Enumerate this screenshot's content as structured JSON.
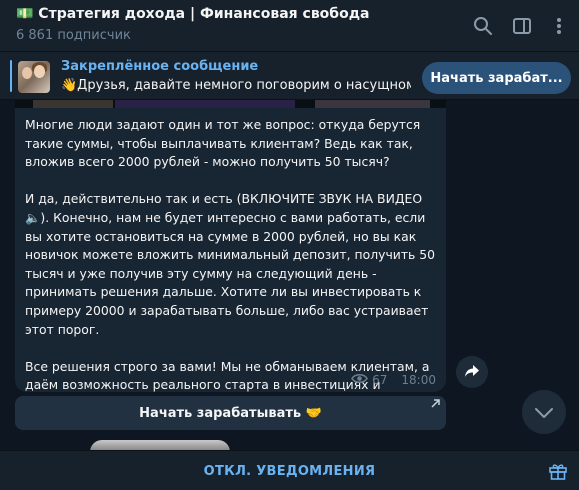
{
  "header": {
    "title": "💵 Стратегия дохода | Финансовая свобода",
    "subscribers": "6 861 подписчик",
    "icons": [
      "search-icon",
      "sidebar-toggle-icon",
      "more-icon"
    ]
  },
  "pinned": {
    "title": "Закреплённое сообщение",
    "text": "👋Друзья, давайте немного поговорим о насущном?...",
    "button_label": "Начать зарабат..."
  },
  "message": {
    "paragraphs": [
      "Многие люди задают один и тот же вопрос: откуда берутся такие суммы, чтобы выплачивать клиентам? Ведь как так, вложив всего 2000 рублей - можно получить 50 тысяч?",
      "И да, действительно так и есть (ВКЛЮЧИТЕ ЗВУК НА ВИДЕО🔈). Конечно, нам не будет интересно с вами работать, если вы хотите остановиться на сумме в 2000 рублей, но вы как новичок можете вложить минимальный депозит, получить 50 тысяч и уже получив эту сумму на следующий день - принимать решения дальше. Хотите ли вы инвестировать к примеру 20000 и зарабатывать больше, либо вас устраивает этот порог.",
      "Все решения строго за вами! Мы не обманываем клиентам, а даём возможность реального старта в инвестициях и зарабатывать так же с нами ПРИЛИЧНЫЕ ДЕНЬГИ!"
    ],
    "views": "67",
    "time": "18:00",
    "inline_button": "Начать зарабатывать 🤝"
  },
  "bottom": {
    "mute_label": "ОТКЛ. УВЕДОМЛЕНИЯ"
  },
  "colors": {
    "background": "#0e1621",
    "panel": "#17212b",
    "bubble": "#182533",
    "accent": "#6ab3f3",
    "button": "#2b5278"
  }
}
